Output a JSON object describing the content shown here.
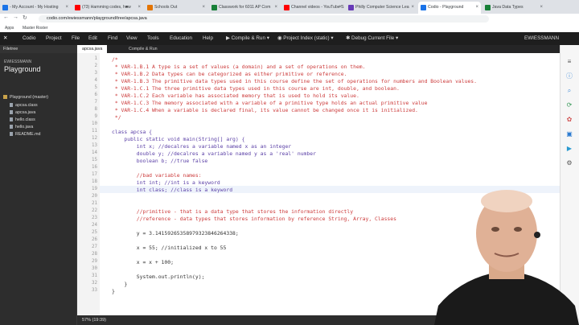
{
  "browser": {
    "tabs": [
      {
        "label": "- My Account - My Hosting",
        "color": "#1a73e8"
      },
      {
        "label": "(73) Hamming codes, h■w",
        "color": "#ff0000"
      },
      {
        "label": "Schools Out",
        "color": "#e37400"
      },
      {
        "label": "Classwork for 6011 AP Com",
        "color": "#188038"
      },
      {
        "label": "Channel videos - YouTube S",
        "color": "#ff0000"
      },
      {
        "label": "Philly Computer Science Lea",
        "color": "#673ab7"
      },
      {
        "label": "Codio - Playground",
        "color": "#1a73e8"
      },
      {
        "label": "Java Data Types",
        "color": "#188038"
      }
    ],
    "url": "codio.com/ewiessmann/playground/tree/apcsa.java",
    "bookmarks": [
      "Apps",
      "Master Roster"
    ]
  },
  "menu": {
    "logo": "Codio",
    "items": [
      "Project",
      "File",
      "Edit",
      "Find",
      "View",
      "Tools",
      "Education",
      "Help"
    ],
    "compile": "Compile & Run",
    "project_index": "Project Index (static)",
    "debug": "Debug Current File",
    "user": "EWIESSMANN"
  },
  "filetree": {
    "header": "Filetree",
    "user": "EWIESSMANN",
    "project": "Playground",
    "root": "Playground (master)",
    "files": [
      "apcsa.class",
      "apcsa.java",
      "hello.class",
      "hello.java",
      "README.md"
    ]
  },
  "editor": {
    "tabs": [
      "apcsa.java",
      "Compile & Run"
    ],
    "lines": [
      {
        "n": "1",
        "t": "/*"
      },
      {
        "n": "2",
        "t": " * VAR-1.B.1 A type is a set of values (a domain) and a set of operations on them."
      },
      {
        "n": "3",
        "t": " * VAR-1.B.2 Data types can be categorized as either primitive or reference."
      },
      {
        "n": "4",
        "t": " * VAR-1.B.3 The primitive data types used in this course define the set of operations for numbers and Boolean values."
      },
      {
        "n": "5",
        "t": " * VAR-1.C.1 The three primitive data types used in this course are int, double, and boolean."
      },
      {
        "n": "6",
        "t": " * VAR-1.C.2 Each variable has associated memory that is used to hold its value."
      },
      {
        "n": "7",
        "t": " * VAR-1.C.3 The memory associated with a variable of a primitive type holds an actual primitive value"
      },
      {
        "n": "8",
        "t": " * VAR-1.C.4 When a variable is declared final, its value cannot be changed once it is initialized."
      },
      {
        "n": "9",
        "t": " */"
      },
      {
        "n": "10",
        "t": ""
      },
      {
        "n": "11",
        "t": "class apcsa {"
      },
      {
        "n": "12",
        "t": "    public static void main(String[] arg) {"
      },
      {
        "n": "13",
        "t": "        int x; //decalres a variable named x as an integer"
      },
      {
        "n": "14",
        "t": "        double y; //decalres a variable named y as a 'real' number"
      },
      {
        "n": "15",
        "t": "        boolean b; //true false"
      },
      {
        "n": "16",
        "t": ""
      },
      {
        "n": "17",
        "t": "        //bad variable names:"
      },
      {
        "n": "18",
        "t": "        int int; //int is a keyword"
      },
      {
        "n": "19",
        "t": "        int class; //class is a keyword"
      },
      {
        "n": "20",
        "t": ""
      },
      {
        "n": "21",
        "t": ""
      },
      {
        "n": "22",
        "t": "        //primitive - that is a data type that stores the information directly"
      },
      {
        "n": "23",
        "t": "        //reference - data types that stores information by reference String, Array, Classes"
      },
      {
        "n": "24",
        "t": ""
      },
      {
        "n": "25",
        "t": "        y = 3.14159265358979323846264338;"
      },
      {
        "n": "26",
        "t": ""
      },
      {
        "n": "27",
        "t": "        x = 55; //initialized x to 55"
      },
      {
        "n": "28",
        "t": ""
      },
      {
        "n": "29",
        "t": "        x = x + 100;"
      },
      {
        "n": "30",
        "t": ""
      },
      {
        "n": "31",
        "t": "        System.out.println(y);"
      },
      {
        "n": "32",
        "t": "    }"
      },
      {
        "n": "33",
        "t": "}"
      }
    ]
  },
  "status": {
    "text": "57%  (19:39)"
  },
  "colors": {
    "comment": "#cc3b3b",
    "keyword": "#5a3fa6",
    "text": "#333333",
    "accent": "#1a73e8"
  }
}
